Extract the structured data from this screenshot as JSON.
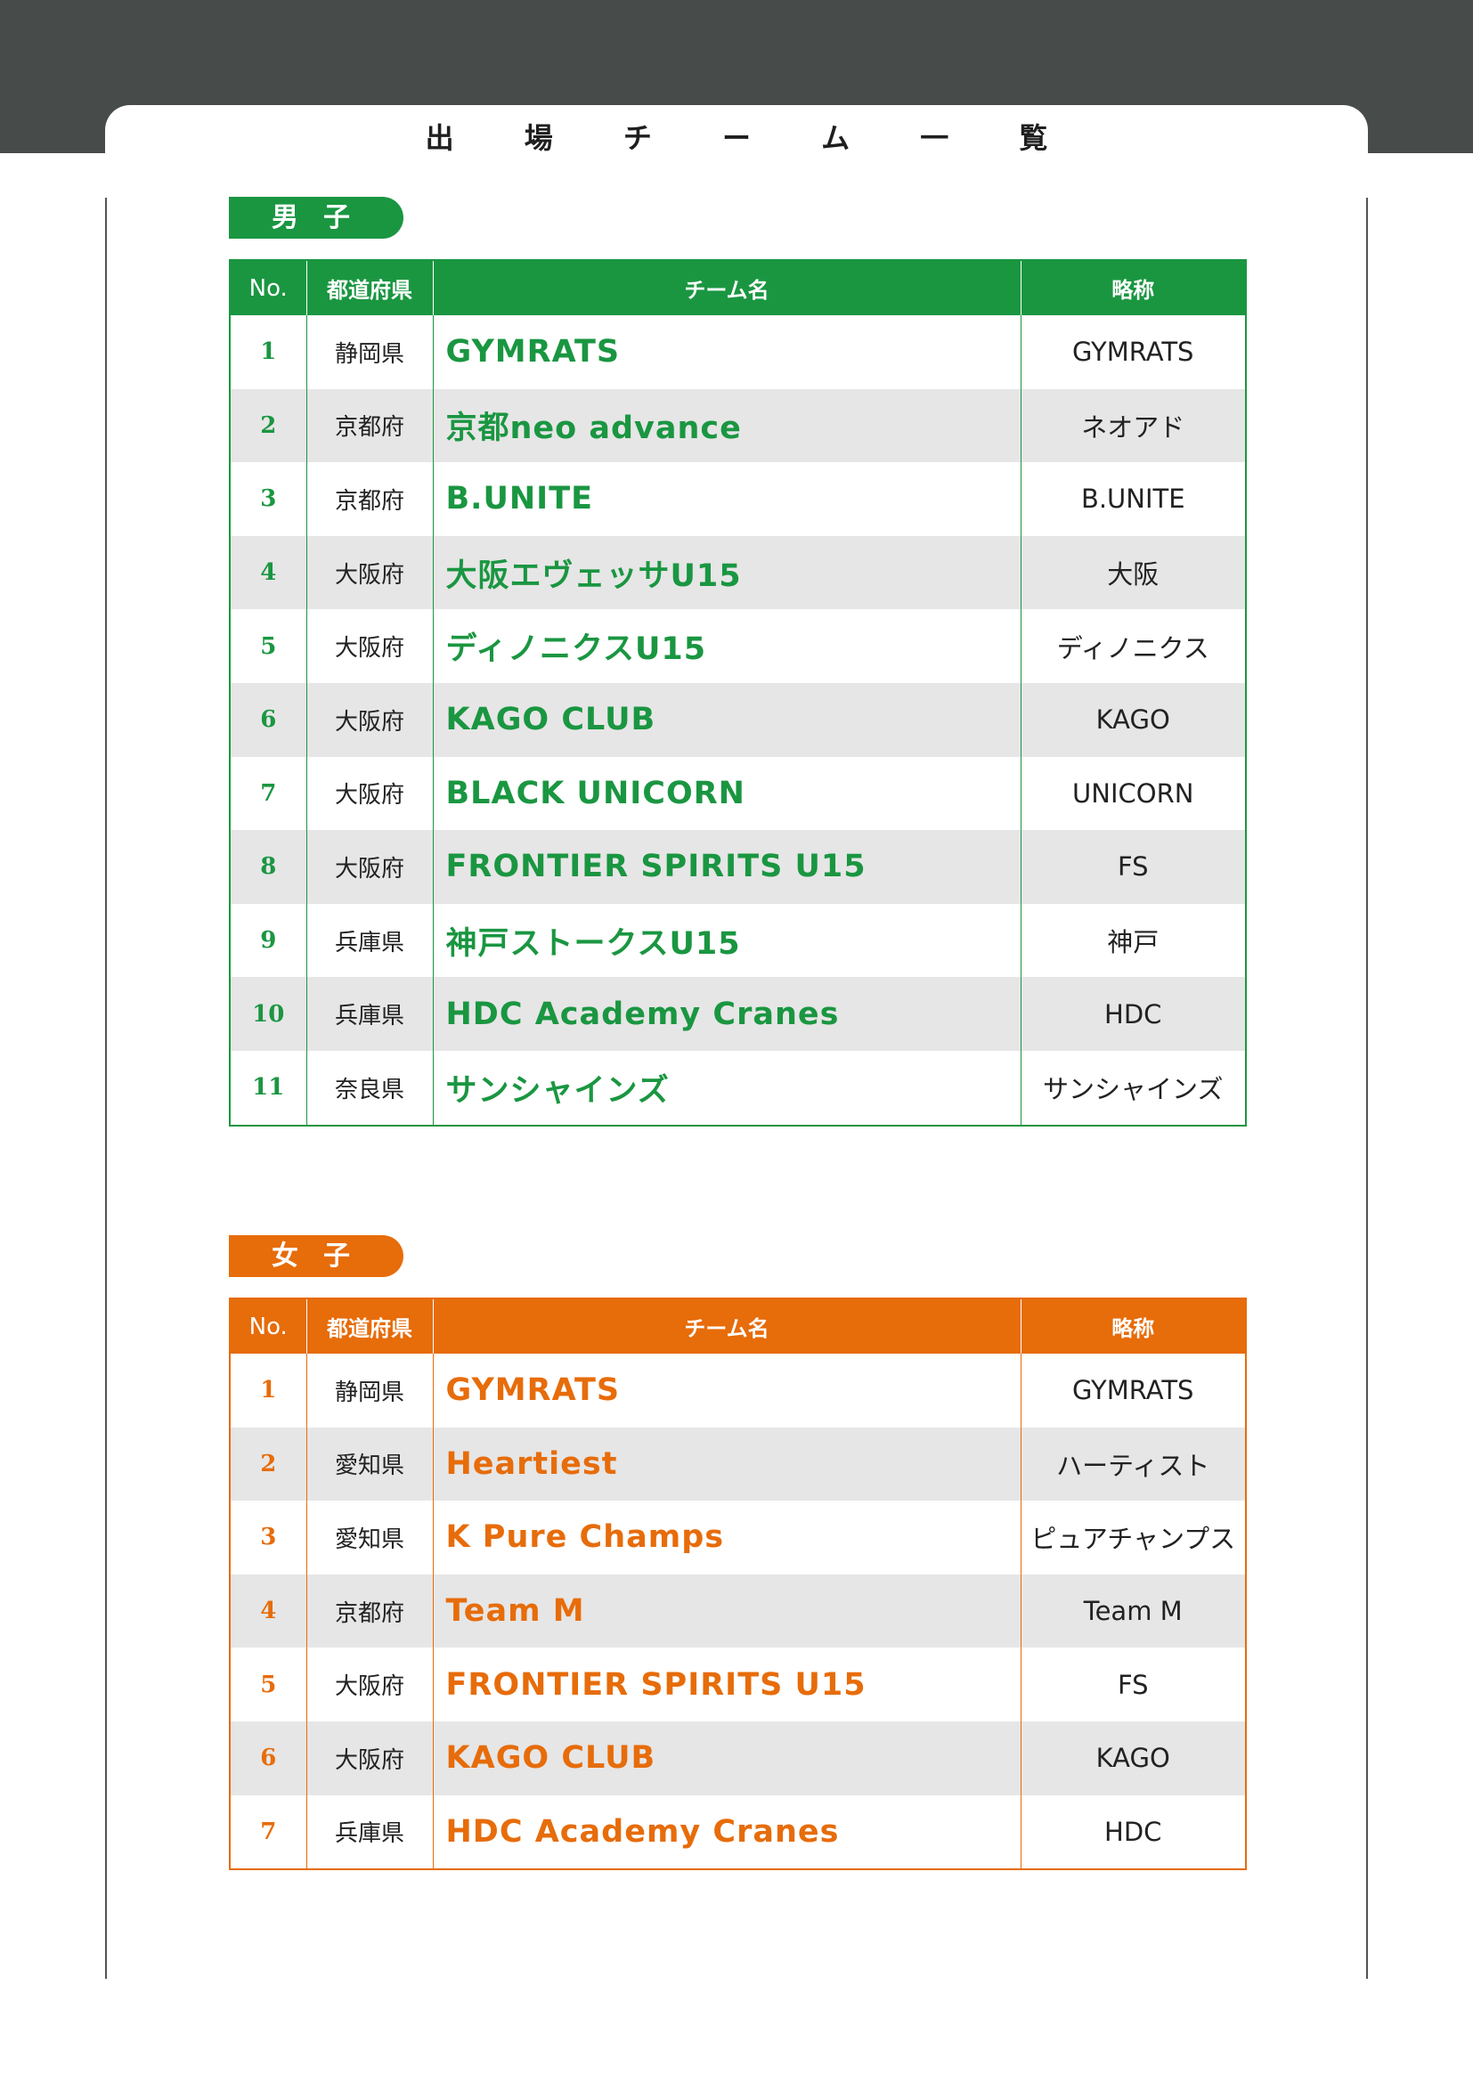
{
  "title": "出 場 チ ー ム 一 覧",
  "colors": {
    "men": "#1a9641",
    "women": "#e76c0a",
    "band": "#474b4a"
  },
  "headers": {
    "no": "No.",
    "prefecture": "都道府県",
    "team": "チーム名",
    "abbr": "略称"
  },
  "men": {
    "label": "男子",
    "rows": [
      {
        "no": "1",
        "prefecture": "静岡県",
        "team": "GYMRATS",
        "abbr": "GYMRATS"
      },
      {
        "no": "2",
        "prefecture": "京都府",
        "team": "京都neo advance",
        "abbr": "ネオアド"
      },
      {
        "no": "3",
        "prefecture": "京都府",
        "team": "B.UNITE",
        "abbr": "B.UNITE"
      },
      {
        "no": "4",
        "prefecture": "大阪府",
        "team": "大阪エヴェッサU15",
        "abbr": "大阪"
      },
      {
        "no": "5",
        "prefecture": "大阪府",
        "team": "ディノニクスU15",
        "abbr": "ディノニクス"
      },
      {
        "no": "6",
        "prefecture": "大阪府",
        "team": "KAGO CLUB",
        "abbr": "KAGO"
      },
      {
        "no": "7",
        "prefecture": "大阪府",
        "team": "BLACK UNICORN",
        "abbr": "UNICORN"
      },
      {
        "no": "8",
        "prefecture": "大阪府",
        "team": "FRONTIER SPIRITS U15",
        "abbr": "FS"
      },
      {
        "no": "9",
        "prefecture": "兵庫県",
        "team": "神戸ストークスU15",
        "abbr": "神戸"
      },
      {
        "no": "10",
        "prefecture": "兵庫県",
        "team": "HDC Academy Cranes",
        "abbr": "HDC"
      },
      {
        "no": "11",
        "prefecture": "奈良県",
        "team": "サンシャインズ",
        "abbr": "サンシャインズ"
      }
    ]
  },
  "women": {
    "label": "女子",
    "rows": [
      {
        "no": "1",
        "prefecture": "静岡県",
        "team": "GYMRATS",
        "abbr": "GYMRATS"
      },
      {
        "no": "2",
        "prefecture": "愛知県",
        "team": "Heartiest",
        "abbr": "ハーティスト"
      },
      {
        "no": "3",
        "prefecture": "愛知県",
        "team": "K Pure Champs",
        "abbr": "ピュアチャンプス"
      },
      {
        "no": "4",
        "prefecture": "京都府",
        "team": "Team M",
        "abbr": "Team M"
      },
      {
        "no": "5",
        "prefecture": "大阪府",
        "team": "FRONTIER SPIRITS U15",
        "abbr": "FS"
      },
      {
        "no": "6",
        "prefecture": "大阪府",
        "team": "KAGO CLUB",
        "abbr": "KAGO"
      },
      {
        "no": "7",
        "prefecture": "兵庫県",
        "team": "HDC Academy Cranes",
        "abbr": "HDC"
      }
    ]
  }
}
